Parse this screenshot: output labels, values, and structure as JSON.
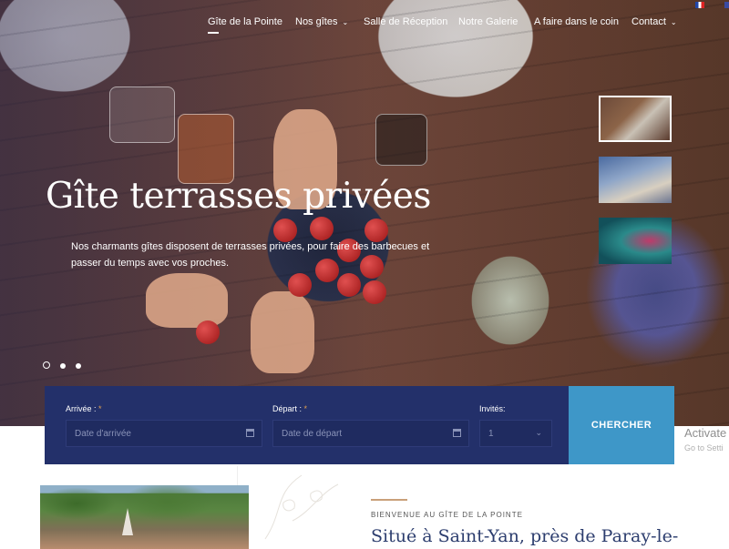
{
  "nav": {
    "items": [
      {
        "label": "Gîte de la Pointe",
        "active": true,
        "dropdown": false
      },
      {
        "label": "Nos gîtes",
        "active": false,
        "dropdown": true
      },
      {
        "label": "Salle de Réception",
        "active": false,
        "dropdown": false
      },
      {
        "label": "Notre Galerie",
        "active": false,
        "dropdown": false
      },
      {
        "label": "A faire dans le coin",
        "active": false,
        "dropdown": false
      },
      {
        "label": "Contact",
        "active": false,
        "dropdown": true
      }
    ],
    "caret": "⌄",
    "flags": [
      "french-flag",
      "uk-flag"
    ]
  },
  "hero": {
    "title": "Gîte terrasses privées",
    "subtitle": "Nos charmants gîtes disposent de terrasses privées, pour faire des barbecues et passer du temps avec vos proches.",
    "slides_total": 3,
    "active_slide": 1
  },
  "booking": {
    "arrival": {
      "label": "Arrivée :",
      "required": "*",
      "placeholder": "Date d'arrivée"
    },
    "departure": {
      "label": "Départ :",
      "required": "*",
      "placeholder": "Date de départ"
    },
    "guests": {
      "label": "Invités:",
      "value": "1",
      "chevron": "⌄"
    },
    "search_label": "CHERCHER"
  },
  "watermark": {
    "line1": "Activate",
    "line2": "Go to Setti"
  },
  "intro": {
    "welcome": "BIENVENUE AU GÎTE DE LA POINTE",
    "heading": "Situé à Saint-Yan, près de Paray-le-"
  },
  "colors": {
    "booking_bg": "#23306a",
    "search_btn": "#3e97c8",
    "accent": "#c9a07a",
    "heading": "#2c3d6e"
  }
}
